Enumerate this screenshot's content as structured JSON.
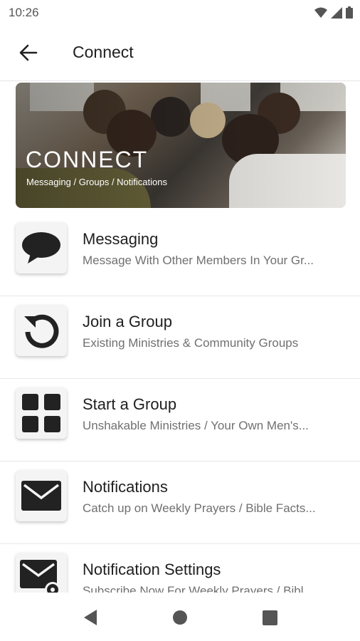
{
  "status_bar": {
    "time": "10:26",
    "icons": [
      "wifi-icon",
      "signal-icon",
      "battery-icon"
    ]
  },
  "app_bar": {
    "title": "Connect",
    "back_icon": "arrow-left-icon"
  },
  "banner": {
    "title": "CONNECT",
    "subtitle": "Messaging / Groups / Notifications"
  },
  "items": [
    {
      "icon": "chat-bubble-icon",
      "title": "Messaging",
      "subtitle": "Message With Other Members In Your Gr..."
    },
    {
      "icon": "refresh-icon",
      "title": "Join a Group",
      "subtitle": "Existing Ministries & Community Groups"
    },
    {
      "icon": "grid-icon",
      "title": "Start a Group",
      "subtitle": "Unshakable Ministries / Your Own Men's..."
    },
    {
      "icon": "envelope-icon",
      "title": "Notifications",
      "subtitle": "Catch up on Weekly Prayers / Bible Facts..."
    },
    {
      "icon": "envelope-gear-icon",
      "title": "Notification Settings",
      "subtitle": "Subscribe Now For Weekly Prayers / Bibl..."
    }
  ],
  "nav_bar": {
    "icons": [
      "back-triangle-icon",
      "home-circle-icon",
      "recents-square-icon"
    ]
  },
  "colors": {
    "icon": "#222222",
    "subtitle": "#707070",
    "divider": "#e8e8e8"
  }
}
